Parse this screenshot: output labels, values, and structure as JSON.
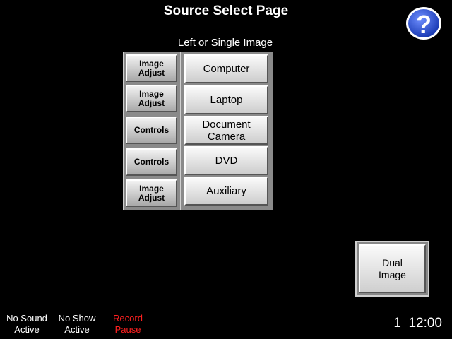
{
  "header": {
    "title": "Source Select Page",
    "help_icon": "question-mark-icon"
  },
  "section": {
    "label": "Left or Single Image"
  },
  "adjust_buttons": [
    "Image\nAdjust",
    "Image\nAdjust",
    "Controls",
    "Controls",
    "Image\nAdjust"
  ],
  "sources": [
    "Computer",
    "Laptop",
    "Document\nCamera",
    "DVD",
    "Auxiliary"
  ],
  "dual": {
    "label": "Dual\nImage"
  },
  "status": {
    "sound": "No Sound\nActive",
    "show": "No Show\nActive",
    "record": "Record\nPause",
    "clock": "1  12:00"
  },
  "colors": {
    "background": "#000000",
    "record": "#ff2020",
    "help": "#2a4fc8"
  }
}
